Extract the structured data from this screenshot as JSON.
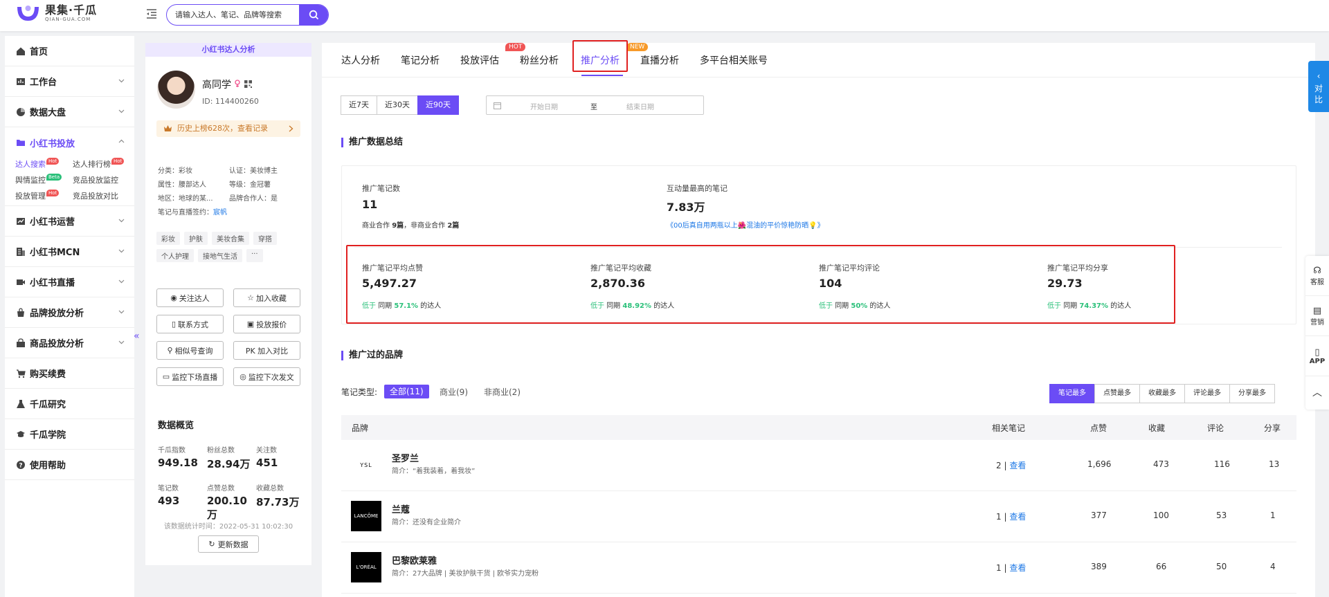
{
  "brand": {
    "name_cn": "果集·千瓜",
    "name_en": "QIAN-GUA.COM",
    "accent": "#6b4cf5"
  },
  "search": {
    "placeholder": "请输入达人、笔记、品牌等搜索"
  },
  "sidebar": {
    "items": [
      {
        "label": "首页"
      },
      {
        "label": "工作台"
      },
      {
        "label": "数据大盘"
      },
      {
        "label": "小红书投放"
      },
      {
        "label": "小红书运营"
      },
      {
        "label": "小红书MCN"
      },
      {
        "label": "小红书直播"
      },
      {
        "label": "品牌投放分析"
      },
      {
        "label": "商品投放分析"
      },
      {
        "label": "购买续费"
      },
      {
        "label": "千瓜研究"
      },
      {
        "label": "千瓜学院"
      },
      {
        "label": "使用帮助"
      }
    ],
    "sub": [
      {
        "label": "达人搜索",
        "tag": "Hot"
      },
      {
        "label": "达人排行榜",
        "tag": "Hot"
      },
      {
        "label": "舆情监控",
        "tag": "Beta"
      },
      {
        "label": "竞品投放监控",
        "tag": ""
      },
      {
        "label": "投放管理",
        "tag": "Hot"
      },
      {
        "label": "竞品投放对比",
        "tag": ""
      }
    ]
  },
  "profile": {
    "header": "小红书达人分析",
    "name": "高同学",
    "id": "ID: 114400260",
    "history": "历史上榜628次，查看记录",
    "info": [
      [
        "分类：彩妆",
        "认证：美妆博主"
      ],
      [
        "属性：腰部达人",
        "等级：金冠薯"
      ],
      [
        "地区：地球的某...",
        "品牌合作人：是"
      ]
    ],
    "sign_label": "笔记与直播签约：",
    "sign_value": "宸帆",
    "tags": [
      "彩妆",
      "护肤",
      "美妆合集",
      "穿搭",
      "个人护理",
      "接地气生活",
      "···"
    ],
    "buttons": [
      "关注达人",
      "加入收藏",
      "联系方式",
      "投放报价",
      "相似号查询",
      "PK 加入对比",
      "监控下场直播",
      "监控下次发文"
    ],
    "overview_title": "数据概览",
    "stats": [
      {
        "label": "千瓜指数",
        "value": "949.18"
      },
      {
        "label": "粉丝总数",
        "value": "28.94万"
      },
      {
        "label": "关注数",
        "value": "451"
      },
      {
        "label": "笔记数",
        "value": "493"
      },
      {
        "label": "点赞总数",
        "value": "200.10万"
      },
      {
        "label": "收藏总数",
        "value": "87.73万"
      }
    ],
    "stat_time": "该数据统计时间：2022-05-31 10:02:30",
    "refresh": "更新数据"
  },
  "tabs": [
    {
      "label": "达人分析"
    },
    {
      "label": "笔记分析"
    },
    {
      "label": "投放评估"
    },
    {
      "label": "粉丝分析",
      "badge": "HOT"
    },
    {
      "label": "推广分析"
    },
    {
      "label": "直播分析",
      "badge": "NEW"
    },
    {
      "label": "多平台相关账号"
    }
  ],
  "range": [
    "近7天",
    "近30天",
    "近90天"
  ],
  "date": {
    "start": "开始日期",
    "sep": "至",
    "end": "结束日期"
  },
  "summary": {
    "title": "推广数据总结",
    "notes_label": "推广笔记数",
    "notes_value": "11",
    "notes_sub": {
      "a": "商业合作",
      "b": "9篇",
      "c": "，非商业合作",
      "d": "2篇"
    },
    "top_label": "互动量最高的笔记",
    "top_value": "7.83万",
    "top_link": "《00后真自用两瓶以上🌺混油的平价惊艳防晒💡》",
    "metrics": [
      {
        "label": "推广笔记平均点赞",
        "value": "5,497.27",
        "pct": "57.1%"
      },
      {
        "label": "推广笔记平均收藏",
        "value": "2,870.36",
        "pct": "48.92%"
      },
      {
        "label": "推广笔记平均评论",
        "value": "104",
        "pct": "50%"
      },
      {
        "label": "推广笔记平均分享",
        "value": "29.73",
        "pct": "74.37%"
      }
    ],
    "low": "低于",
    "same": "同期",
    "suffix": "的达人"
  },
  "brands_section": {
    "title": "推广过的品牌",
    "type_label": "笔记类型:",
    "types": [
      "全部(11)",
      "商业(9)",
      "非商业(2)"
    ],
    "sorts": [
      "笔记最多",
      "点赞最多",
      "收藏最多",
      "评论最多",
      "分享最多"
    ],
    "headers": [
      "品牌",
      "相关笔记",
      "点赞",
      "收藏",
      "评论",
      "分享"
    ],
    "view": "查看",
    "rows": [
      {
        "name": "圣罗兰",
        "desc": "简介：“着我装着，着我妆”",
        "logo": "YSL",
        "notes": "2 |",
        "likes": "1,696",
        "fav": "473",
        "comments": "116",
        "shares": "13"
      },
      {
        "name": "兰蔻",
        "desc": "简介：还没有企业简介",
        "logo": "LANCÔME",
        "notes": "1 |",
        "likes": "377",
        "fav": "100",
        "comments": "53",
        "shares": "1"
      },
      {
        "name": "巴黎欧莱雅",
        "desc": "简介：27大品牌 | 美妆护肤干货 | 欧爷实力宠粉",
        "logo": "L'ORÉAL",
        "notes": "1 |",
        "likes": "389",
        "fav": "66",
        "comments": "50",
        "shares": "4"
      }
    ]
  },
  "float": {
    "compare": "对比",
    "items": [
      "客服",
      "营销",
      "APP"
    ]
  }
}
